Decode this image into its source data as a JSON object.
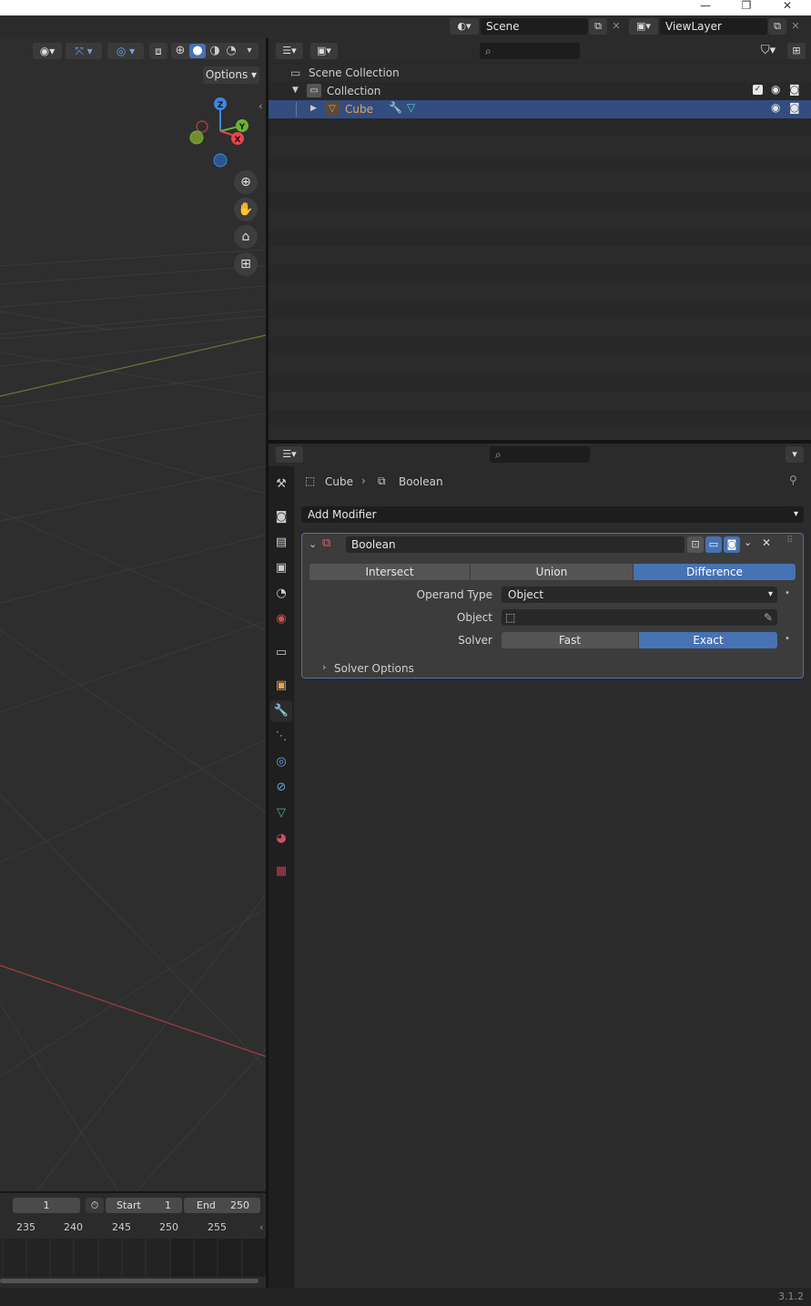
{
  "window": {
    "minimize": "—",
    "restore": "❐",
    "close": "✕"
  },
  "topbar": {
    "scene_name": "Scene",
    "viewlayer_name": "ViewLayer"
  },
  "viewport": {
    "options_label": "Options",
    "gizmo": {
      "z": "Z",
      "y": "Y",
      "x": "X"
    }
  },
  "timeline": {
    "current_frame": "1",
    "start_label": "Start",
    "start_value": "1",
    "end_label": "End",
    "end_value": "250",
    "ruler": [
      "235",
      "240",
      "245",
      "250",
      "255"
    ]
  },
  "outliner": {
    "scene_collection": "Scene Collection",
    "collection": "Collection",
    "object": "Cube"
  },
  "properties": {
    "breadcrumb_object": "Cube",
    "breadcrumb_modifier": "Boolean",
    "add_modifier": "Add Modifier",
    "modifier": {
      "name": "Boolean",
      "operations": [
        "Intersect",
        "Union",
        "Difference"
      ],
      "active_operation": "Difference",
      "operand_type_label": "Operand Type",
      "operand_type_value": "Object",
      "object_label": "Object",
      "object_value": "",
      "solver_label": "Solver",
      "solvers": [
        "Fast",
        "Exact"
      ],
      "active_solver": "Exact",
      "solver_options": "Solver Options"
    }
  },
  "status": {
    "version": "3.1.2"
  },
  "colors": {
    "accent": "#4772b3",
    "selection_row": "#334d80",
    "object_orange": "#e8a25a",
    "x_axis": "#e9444e",
    "y_axis": "#6bb233",
    "z_axis": "#3d87e0"
  }
}
